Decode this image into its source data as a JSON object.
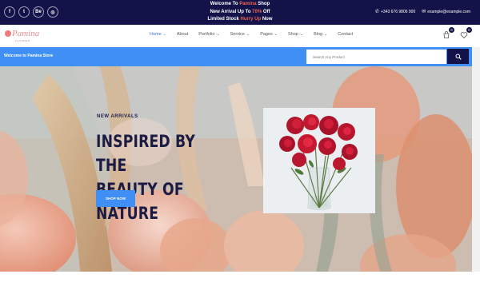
{
  "topbar": {
    "socials": [
      {
        "icon": "facebook-icon",
        "glyph": "f"
      },
      {
        "icon": "twitter-icon",
        "glyph": "t"
      },
      {
        "icon": "behance-icon",
        "glyph": "Be"
      },
      {
        "icon": "instagram-icon",
        "glyph": "◎"
      }
    ],
    "promo": {
      "line1_pre": "Welcome To ",
      "line1_accent": "Pamina",
      "line1_post": " Shop",
      "line2_pre": "New Arrival Up To ",
      "line2_accent": "70%",
      "line2_post": " Off",
      "line3_pre": "Limited Stock ",
      "line3_accent": "Hurry Up",
      "line3_post": " Now"
    },
    "phone": "+343 676 9806 900",
    "email": "example@example.com"
  },
  "nav": {
    "logo_text": "Pamina",
    "logo_sub": "FLOWER",
    "items": [
      {
        "label": "Home",
        "active": true,
        "dropdown": true
      },
      {
        "label": "About",
        "active": false,
        "dropdown": false
      },
      {
        "label": "Portfolio",
        "active": false,
        "dropdown": true
      },
      {
        "label": "Service",
        "active": false,
        "dropdown": true
      },
      {
        "label": "Pages",
        "active": false,
        "dropdown": true
      },
      {
        "label": "Shop",
        "active": false,
        "dropdown": true
      },
      {
        "label": "Blog",
        "active": false,
        "dropdown": true
      },
      {
        "label": "Contact",
        "active": false,
        "dropdown": false
      }
    ],
    "cart_count": "0",
    "wishlist_count": "0"
  },
  "searchbar": {
    "welcome": "Welcome to Pamina Store",
    "placeholder": "Search Any Product"
  },
  "hero": {
    "kicker": "NEW ARRIVALS",
    "title_line1": "INSPIRED BY THE",
    "title_line2": "BEAUTY OF NATURE",
    "button": "SHOP NOW"
  },
  "colors": {
    "navy": "#13134a",
    "blue": "#3f8ff5",
    "accent": "#f0614e"
  }
}
